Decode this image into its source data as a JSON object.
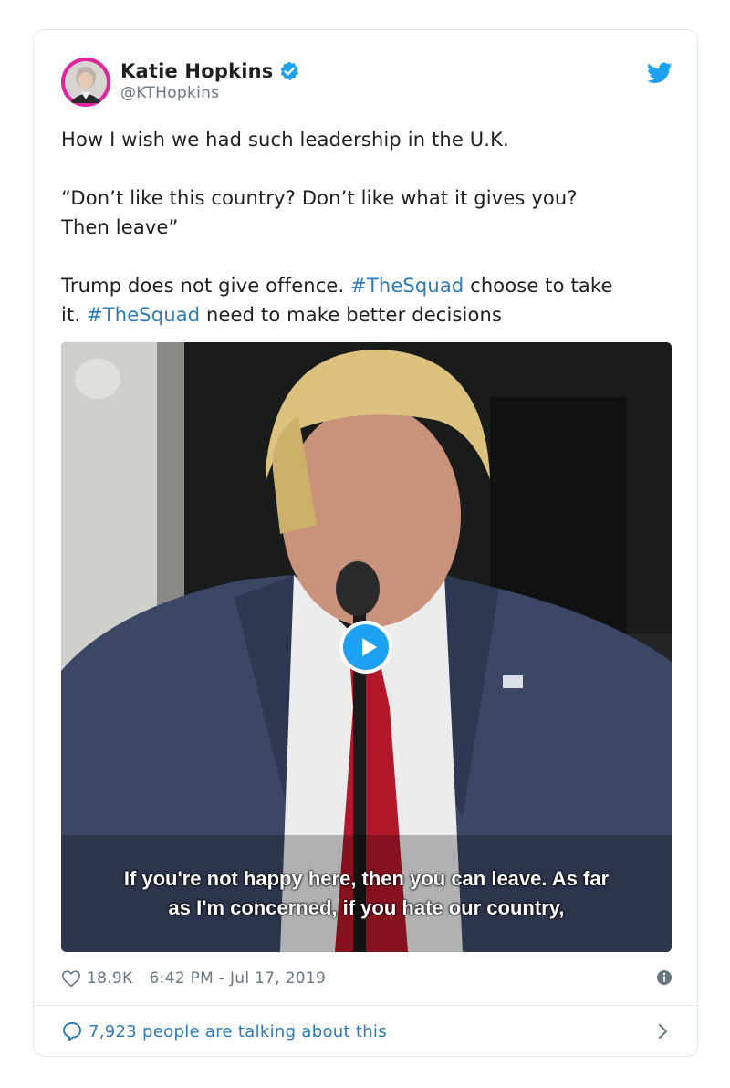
{
  "author": {
    "display_name": "Katie Hopkins",
    "handle": "@KTHopkins"
  },
  "tweet": {
    "line1": "How I wish we had such leadership in the U.K.",
    "line2": "“Don’t like this country? Don’t like what it gives you?",
    "line3": "Then leave”",
    "line4_pre": "Trump does not give offence. ",
    "hashtag1": "#TheSquad",
    "line4_mid": " choose to take",
    "line5_pre": "it. ",
    "hashtag2": "#TheSquad",
    "line5_post": " need to make better decisions"
  },
  "video": {
    "caption_line1": "If you're not happy here, then you can leave. As far",
    "caption_line2": "as I'm concerned, if you hate our country,"
  },
  "meta": {
    "like_count": "18.9K",
    "timestamp": "6:42 PM - Jul 17, 2019"
  },
  "conversation": {
    "label": "7,923 people are talking about this"
  },
  "icons": {
    "verified": "verified-badge-icon",
    "brand": "twitter-bird-icon",
    "like": "heart-icon",
    "info": "info-icon",
    "reply": "speech-bubble-icon",
    "more": "chevron-right-icon",
    "play": "play-icon"
  },
  "colors": {
    "accent": "#1da1f2",
    "link": "#2b7bb9",
    "muted": "#697882",
    "text": "#1c2022",
    "border": "#e1e8ed",
    "avatar_ring": "#e0249d"
  }
}
